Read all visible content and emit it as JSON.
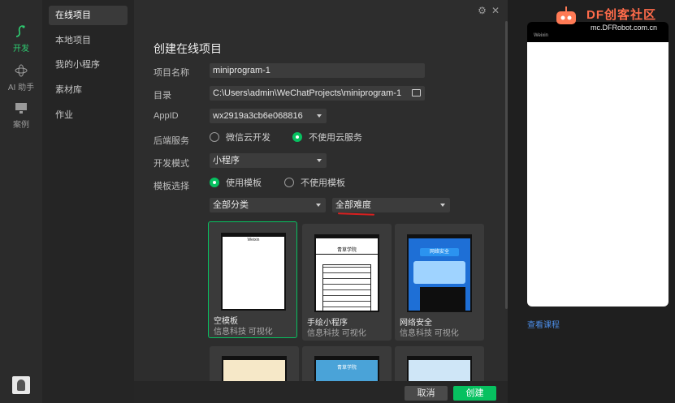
{
  "activity": {
    "items": [
      {
        "label": "开发",
        "icon": "code-icon"
      },
      {
        "label": "AI 助手",
        "icon": "atom-icon"
      },
      {
        "label": "案例",
        "icon": "monitor-icon"
      }
    ]
  },
  "nav": {
    "items": [
      "在线项目",
      "本地项目",
      "我的小程序",
      "素材库",
      "作业"
    ]
  },
  "dialog": {
    "title": "创建在线项目",
    "project_name_label": "项目名称",
    "project_name_value": "miniprogram-1",
    "directory_label": "目录",
    "directory_value": "C:\\Users\\admin\\WeChatProjects\\miniprogram-1",
    "appid_label": "AppID",
    "appid_value": "wx2919a3cb6e068816",
    "backend_label": "后端服务",
    "backend_options": [
      "微信云开发",
      "不使用云服务"
    ],
    "backend_selected": "不使用云服务",
    "dev_mode_label": "开发模式",
    "dev_mode_value": "小程序",
    "template_label": "模板选择",
    "template_options": [
      "使用模板",
      "不使用模板"
    ],
    "template_selected": "使用模板",
    "category_value": "全部分类",
    "difficulty_value": "全部难度"
  },
  "templates": [
    {
      "name": "空模板",
      "tags": "信息科技 可视化"
    },
    {
      "name": "手绘小程序",
      "tags": "信息科技 可视化",
      "header": "青草学院"
    },
    {
      "name": "网络安全",
      "tags": "信息科技 可视化",
      "header": "网络安全"
    }
  ],
  "templates_row2": [
    {
      "header": ""
    },
    {
      "header": "青草学院"
    },
    {
      "header": ""
    }
  ],
  "footer": {
    "cancel": "取消",
    "create": "创建"
  },
  "preview": {
    "view_course": "查看课程",
    "watermark_brand": "DF创客社区",
    "watermark_url": "mc.DFRobot.com.cn",
    "wechat_label": "Weixin"
  },
  "colors": {
    "accent": "#07c160",
    "link": "#4c8ee8",
    "annotation": "#d82020"
  }
}
